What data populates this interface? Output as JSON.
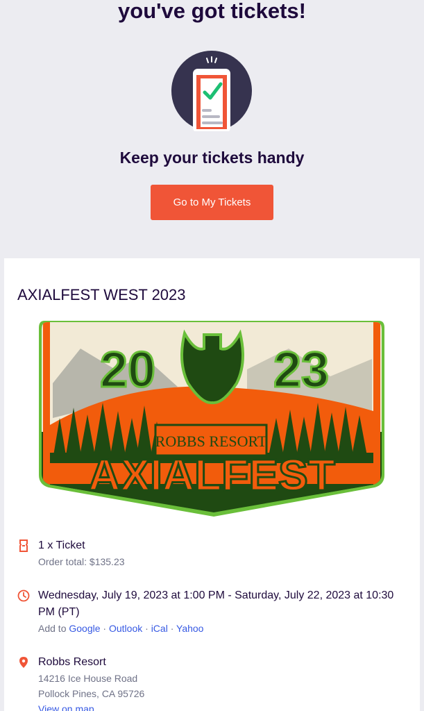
{
  "header": {
    "title": "you've got tickets!",
    "subtitle": "Keep your tickets handy",
    "cta_label": "Go to My Tickets"
  },
  "event": {
    "name": "AXIALFEST WEST 2023",
    "logo": {
      "year_left": "20",
      "year_right": "23",
      "banner": "ROBBS RESORT",
      "wordmark": "AXIALFEST",
      "colors": {
        "orange": "#f25c0c",
        "green": "#1f4a12",
        "cream": "#f2ead6",
        "lime": "#6abf3a"
      }
    }
  },
  "ticket": {
    "quantity_label": "1 x Ticket",
    "order_total": "Order total: $135.23"
  },
  "datetime": {
    "range": "Wednesday, July 19, 2023 at 1:00 PM - Saturday, July 22, 2023 at 10:30 PM (PT)",
    "add_to_label": "Add to",
    "calendars": [
      "Google",
      "Outlook",
      "iCal",
      "Yahoo"
    ],
    "separator": "·"
  },
  "location": {
    "venue": "Robbs Resort",
    "address_line1": "14216 Ice House Road",
    "address_line2": "Pollock Pines, CA 95726",
    "map_link": "View on map"
  },
  "colors": {
    "brand_orange": "#f05537",
    "text_dark": "#1e0a3c",
    "text_muted": "#6f7287",
    "link_blue": "#3659e3",
    "page_bg": "#ececf1"
  }
}
